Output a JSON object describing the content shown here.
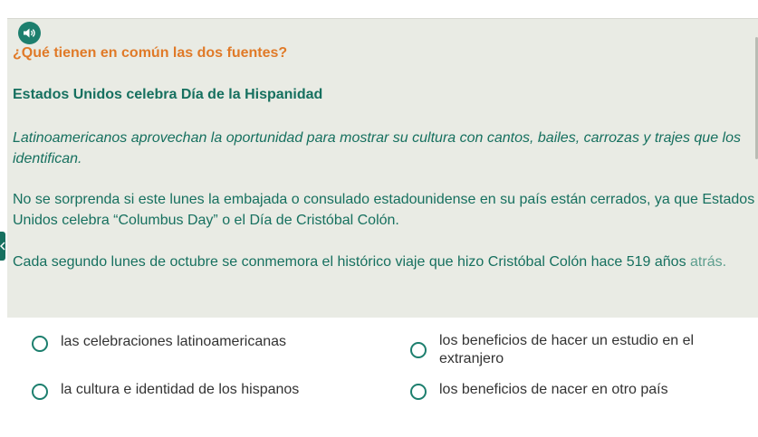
{
  "question": {
    "text": "¿Qué tienen en común las dos fuentes?",
    "audio_icon": "speaker-icon"
  },
  "article": {
    "title": "Estados Unidos celebra Día de la Hispanidad",
    "paragraphs": [
      "Latinoamericanos aprovechan la oportunidad para mostrar su cultura con cantos, bailes, carrozas y trajes que los identifican.",
      "No se sorprenda si este lunes la embajada o consulado estadounidense en su país están cerrados, ya que Estados Unidos celebra “Columbus Day” o el Día de Cristóbal Colón.",
      "Cada segundo lunes de octubre se conmemora el histórico viaje que hizo Cristóbal Colón hace 519 años"
    ],
    "paragraph3_continuation": "atrás."
  },
  "options": [
    {
      "label": "las celebraciones latinoamericanas"
    },
    {
      "label": "los beneficios de hacer un estudio en el extranjero"
    },
    {
      "label": "la cultura e identidad de los hispanos"
    },
    {
      "label": "los beneficios de nacer en otro país"
    }
  ],
  "colors": {
    "accent_orange": "#e07a28",
    "accent_teal": "#16705f",
    "panel_bg": "#e9ebe4"
  }
}
